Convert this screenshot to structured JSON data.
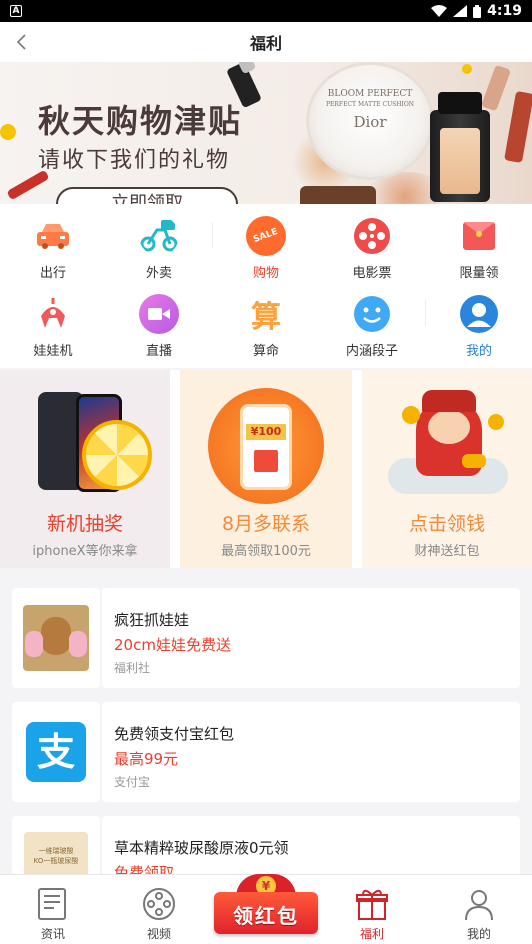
{
  "status_bar": {
    "app_badge": "A",
    "time": "4:19"
  },
  "header": {
    "title": "福利"
  },
  "banner": {
    "headline": "秋天购物津贴",
    "subline": "请收下我们的礼物",
    "cta": "立即领取",
    "compact_brand_top": "BLOOM PERFECT",
    "compact_brand_mid": "PERFECT MATTE CUSHION",
    "compact_brand_main": "Dior"
  },
  "grid": {
    "items": [
      {
        "label": "出行",
        "icon": "car-icon",
        "color": "#ff7a45"
      },
      {
        "label": "外卖",
        "icon": "scooter-icon",
        "color": "#21b9c9"
      },
      {
        "label": "购物",
        "icon": "shopping-tag-icon",
        "color": "#ff6b2c",
        "icon_text": "SALE"
      },
      {
        "label": "电影票",
        "icon": "film-reel-icon",
        "color": "#f04a4a"
      },
      {
        "label": "限量领",
        "icon": "red-envelope-icon",
        "color": "#f25858"
      },
      {
        "label": "娃娃机",
        "icon": "claw-machine-icon",
        "color": "#f15a5a"
      },
      {
        "label": "直播",
        "icon": "video-camera-icon",
        "color": "#d46ae8"
      },
      {
        "label": "算命",
        "icon": "fortune-icon",
        "color": "#ffa03a",
        "icon_text": "算"
      },
      {
        "label": "内涵段子",
        "icon": "smiley-icon",
        "color": "#3fa9f5"
      },
      {
        "label": "我的",
        "icon": "user-avatar-icon",
        "color": "#2a86dd"
      }
    ]
  },
  "promos": [
    {
      "title": "新机抽奖",
      "sub": "iphoneX等你来拿",
      "title_color": "#e8412c",
      "bg": "#f2ecee"
    },
    {
      "title": "8月多联系",
      "sub": "最高领取100元",
      "title_color": "#f28a3a",
      "bg": "#fdf0df",
      "amount": "¥100"
    },
    {
      "title": "点击领钱",
      "sub": "财神送红包",
      "title_color": "#f28a3a",
      "bg": "#fdf3e7"
    }
  ],
  "list": [
    {
      "title": "疯狂抓娃娃",
      "price": "20cm娃娃免费送",
      "source": "福利社",
      "thumb": "plush-toys-image"
    },
    {
      "title": "免费领支付宝红包",
      "price": "最高99元",
      "source": "支付宝",
      "thumb": "alipay-logo",
      "thumb_text": "支"
    },
    {
      "title": "草本精粹玻尿酸原液0元领",
      "price": "免费领取",
      "source": "",
      "thumb": "serum-product-image",
      "thumb_text": "一维瑞玻酸\nKO一瓶玻尿酸"
    }
  ],
  "bottom_nav": {
    "items": [
      {
        "label": "资讯",
        "icon": "news-icon"
      },
      {
        "label": "视频",
        "icon": "film-icon"
      },
      {
        "label": "福利",
        "icon": "gift-icon",
        "active": true
      },
      {
        "label": "我的",
        "icon": "person-icon"
      }
    ],
    "center_button": {
      "label": "领红包",
      "coin": "¥"
    }
  }
}
